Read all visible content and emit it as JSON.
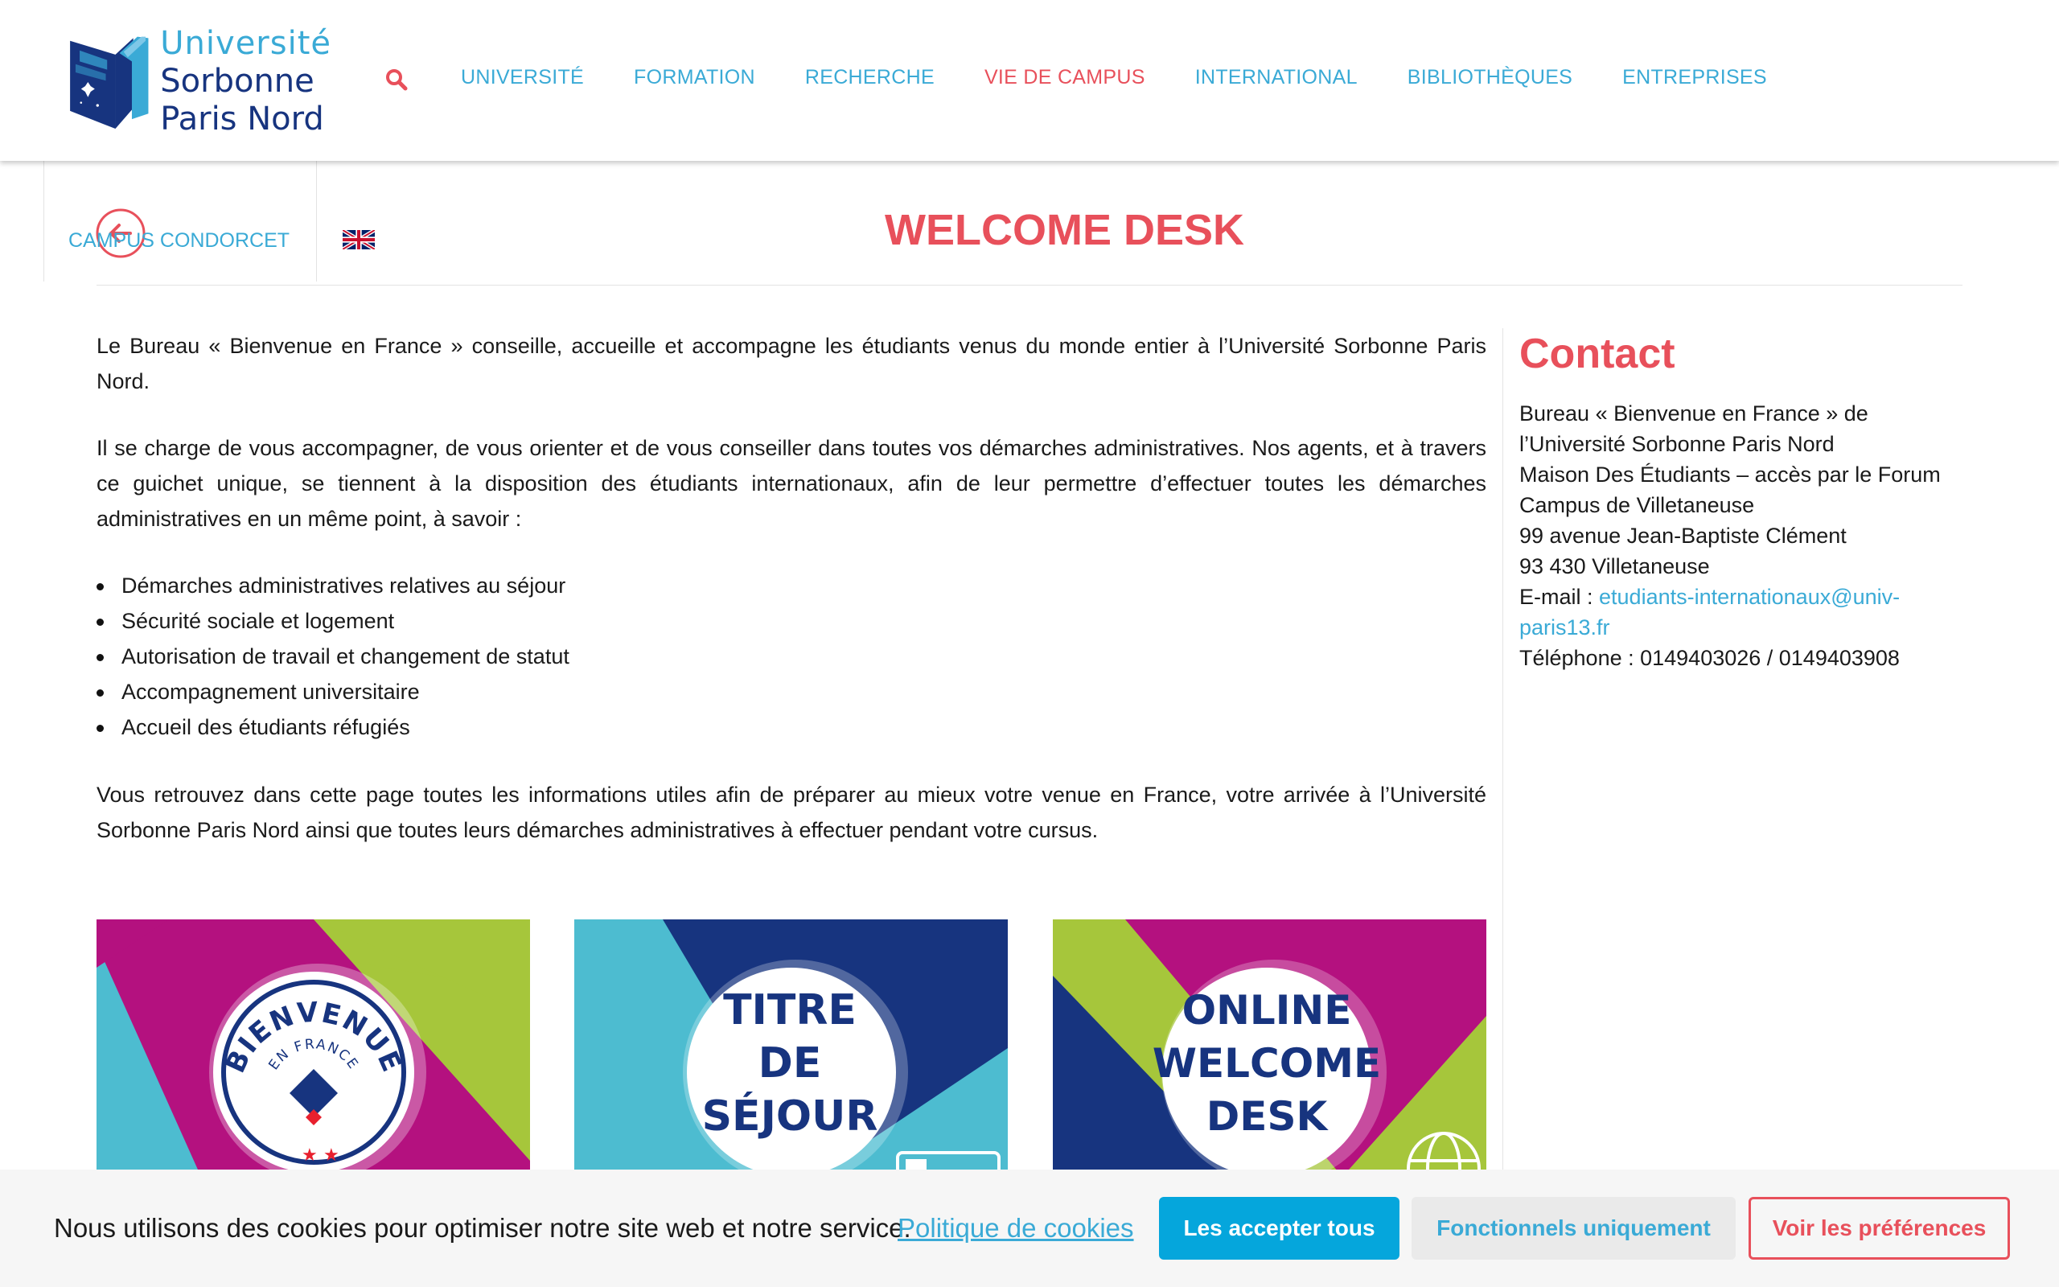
{
  "header": {
    "logo": {
      "line1": "Université",
      "line2": "Sorbonne",
      "line3": "Paris Nord"
    },
    "search_icon": "search-icon",
    "nav": [
      {
        "label": "UNIVERSITÉ",
        "active": false
      },
      {
        "label": "FORMATION",
        "active": false
      },
      {
        "label": "RECHERCHE",
        "active": false
      },
      {
        "label": "VIE DE CAMPUS",
        "active": true
      },
      {
        "label": "INTERNATIONAL",
        "active": false
      },
      {
        "label": "BIBLIOTHÈQUES",
        "active": false
      },
      {
        "label": "ENTREPRISES",
        "active": false
      }
    ]
  },
  "subheader": {
    "campus_link": "CAMPUS CONDORCET",
    "back_icon": "arrow-left-circle-icon",
    "language_icon": "uk-flag-icon",
    "page_title": "WELCOME DESK"
  },
  "main": {
    "intro": "Le Bureau « Bienvenue en France » conseille, accueille et accompagne les étudiants venus du monde entier à l’Université Sorbonne Paris Nord.",
    "description": "Il se charge de vous accompagner, de vous orienter et de vous conseiller dans toutes vos démarches administratives. Nos agents, et à travers ce guichet unique, se tiennent à la disposition des étudiants internationaux, afin de leur permettre d’effectuer toutes les démarches administratives en un même point, à savoir :",
    "services": [
      "Démarches administratives relatives au séjour",
      "Sécurité sociale et logement",
      "Autorisation de travail et changement de statut",
      "Accompagnement universitaire",
      "Accueil des étudiants réfugiés"
    ],
    "outro": "Vous retrouvez dans cette page toutes les informations utiles afin de préparer au mieux votre venue en France, votre arrivée à l’Université Sorbonne Paris Nord ainsi que toutes leurs démarches administratives à effectuer pendant votre cursus.",
    "cards": [
      {
        "top": "BIENVENUE",
        "sub": "EN FRANCE"
      },
      {
        "line1": "TITRE",
        "line2": "DE",
        "line3": "SÉJOUR"
      },
      {
        "line1": "ONLINE",
        "line2": "WELCOME",
        "line3": "DESK"
      }
    ]
  },
  "contact": {
    "title": "Contact",
    "lines": [
      "Bureau « Bienvenue en France » de l’Université Sorbonne Paris Nord",
      "Maison Des Étudiants – accès par le Forum",
      "Campus de Villetaneuse",
      "99 avenue Jean-Baptiste Clément",
      "93 430 Villetaneuse"
    ],
    "email_label": "E-mail : ",
    "email": "etudiants-internationaux@univ-paris13.fr",
    "phone": "Téléphone : 0149403026 / 0149403908"
  },
  "cookie": {
    "text": "Nous utilisons des cookies pour optimiser notre site web et notre service.",
    "policy_link": "Politique de cookies",
    "accept_all": "Les accepter tous",
    "functional_only": "Fonctionnels uniquement",
    "preferences": "Voir les préférences"
  },
  "colors": {
    "brand_blue": "#3aaad6",
    "brand_navy": "#17347f",
    "accent_red": "#e8505b",
    "accept_button": "#05a6dc"
  }
}
